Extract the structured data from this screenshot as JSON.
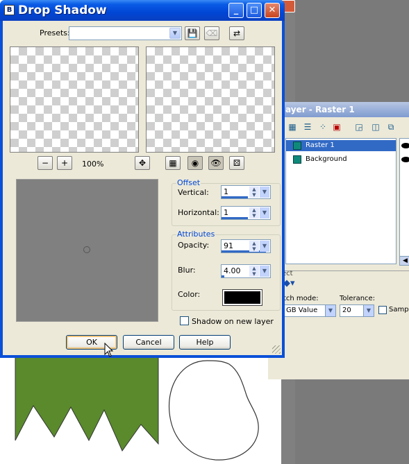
{
  "dialog": {
    "title": "Drop Shadow",
    "icon_letter": "B",
    "presets_label": "Presets:",
    "presets_value": "",
    "zoom_level": "100%",
    "offset_group": "Offset",
    "vertical_label": "Vertical:",
    "vertical_value": "1",
    "horizontal_label": "Horizontal:",
    "horizontal_value": "1",
    "attributes_group": "Attributes",
    "opacity_label": "Opacity:",
    "opacity_value": "91",
    "blur_label": "Blur:",
    "blur_value": "4.00",
    "color_label": "Color:",
    "shadow_color": "#000000",
    "shadow_new_layer_label": "Shadow on new layer",
    "shadow_new_layer_checked": false,
    "ok_label": "OK",
    "cancel_label": "Cancel",
    "help_label": "Help"
  },
  "layer_palette": {
    "title": "ayer - Raster 1",
    "layers": [
      {
        "name": "Raster 1",
        "selected": true
      },
      {
        "name": "Background",
        "selected": false
      }
    ]
  },
  "tool_options": {
    "match_mode_label": "tch mode:",
    "match_mode_value": "GB Value",
    "tolerance_label": "Tolerance:",
    "tolerance_value": "20",
    "sample_label": "Sampl"
  },
  "colors": {
    "title_bar": "#0046d5",
    "dialog_bg": "#ece9d8",
    "group_title": "#0046d5",
    "shape_fill": "#5a8a2c"
  }
}
